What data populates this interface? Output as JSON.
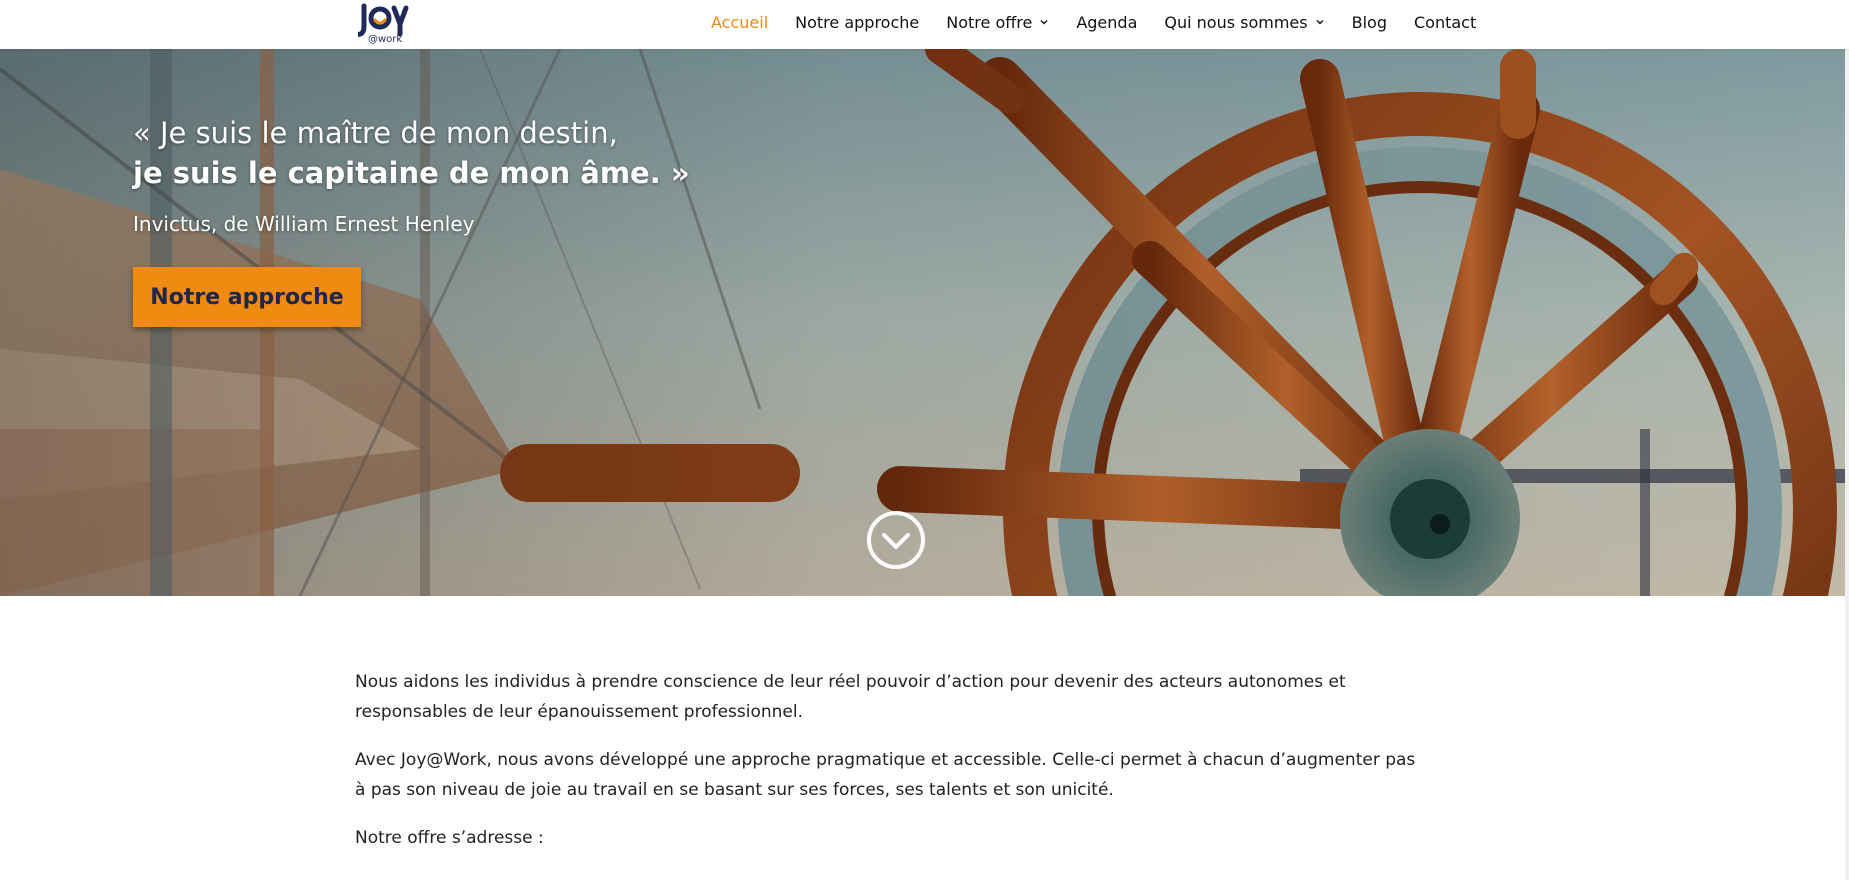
{
  "brand": {
    "logo_text": "JOY",
    "logo_sub": "@work",
    "accent_color": "#ee8a12",
    "dark_color": "#1f2a5a"
  },
  "nav": {
    "items": [
      {
        "label": "Accueil",
        "active": true,
        "has_dropdown": false
      },
      {
        "label": "Notre approche",
        "active": false,
        "has_dropdown": false
      },
      {
        "label": "Notre offre",
        "active": false,
        "has_dropdown": true
      },
      {
        "label": "Agenda",
        "active": false,
        "has_dropdown": false
      },
      {
        "label": "Qui nous sommes",
        "active": false,
        "has_dropdown": true
      },
      {
        "label": "Blog",
        "active": false,
        "has_dropdown": false
      },
      {
        "label": "Contact",
        "active": false,
        "has_dropdown": false
      }
    ],
    "dropdown_icon": "chevron-down-icon"
  },
  "hero": {
    "quote_line1": "« Je suis le maître de mon destin,",
    "quote_line2": "je suis le capitaine de mon âme. »",
    "attribution": "Invictus, de William Ernest Henley",
    "cta_label": "Notre approche",
    "cta_color": "#f08a10",
    "scroll_icon": "circle-chevron-down-icon",
    "image_subject": "ship-wheel"
  },
  "content": {
    "paragraphs": [
      "Nous aidons les individus à prendre conscience de leur réel pouvoir d’action pour devenir des acteurs autonomes et responsables de leur épanouissement professionnel.",
      "Avec Joy@Work, nous avons développé une approche pragmatique et accessible. Celle-ci permet à chacun d’augmenter pas à pas son niveau de joie au travail en se basant sur ses forces, ses talents et son unicité.",
      "Notre offre s’adresse :"
    ]
  }
}
